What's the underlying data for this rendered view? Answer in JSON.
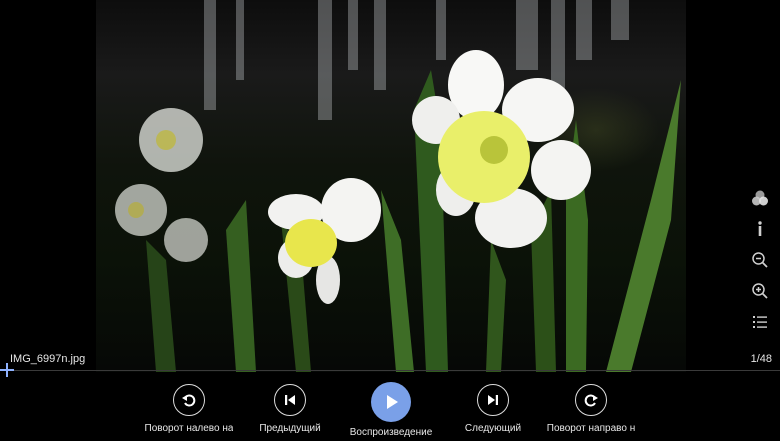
{
  "file": {
    "name": "IMG_6997n.jpg",
    "position": "1/48"
  },
  "side_tools": [
    {
      "icon": "filters-icon"
    },
    {
      "icon": "info-icon"
    },
    {
      "icon": "zoom-out-icon"
    },
    {
      "icon": "zoom-in-icon"
    },
    {
      "icon": "list-icon"
    }
  ],
  "controls": {
    "rotate_left": "Поворот налево на",
    "previous": "Предыдущий",
    "play": "Воспроизведение",
    "next": "Следующий",
    "rotate_right": "Поворот направо н"
  },
  "colors": {
    "accent": "#7aa0e8"
  }
}
